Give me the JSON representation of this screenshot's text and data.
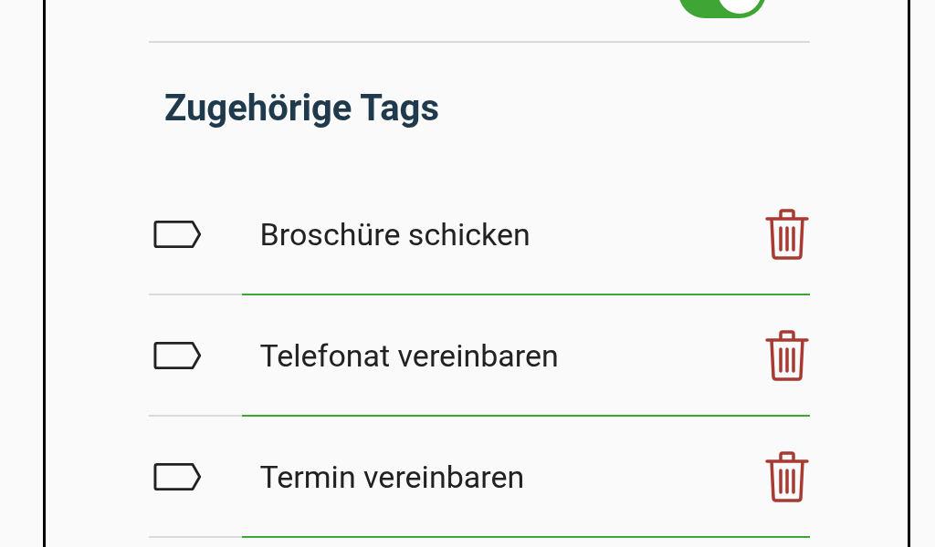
{
  "toggle": {
    "on": true
  },
  "section_title": "Zugehörige Tags",
  "tags": [
    {
      "label": "Broschüre schicken"
    },
    {
      "label": "Telefonat vereinbaren"
    },
    {
      "label": "Termin vereinbaren"
    }
  ]
}
